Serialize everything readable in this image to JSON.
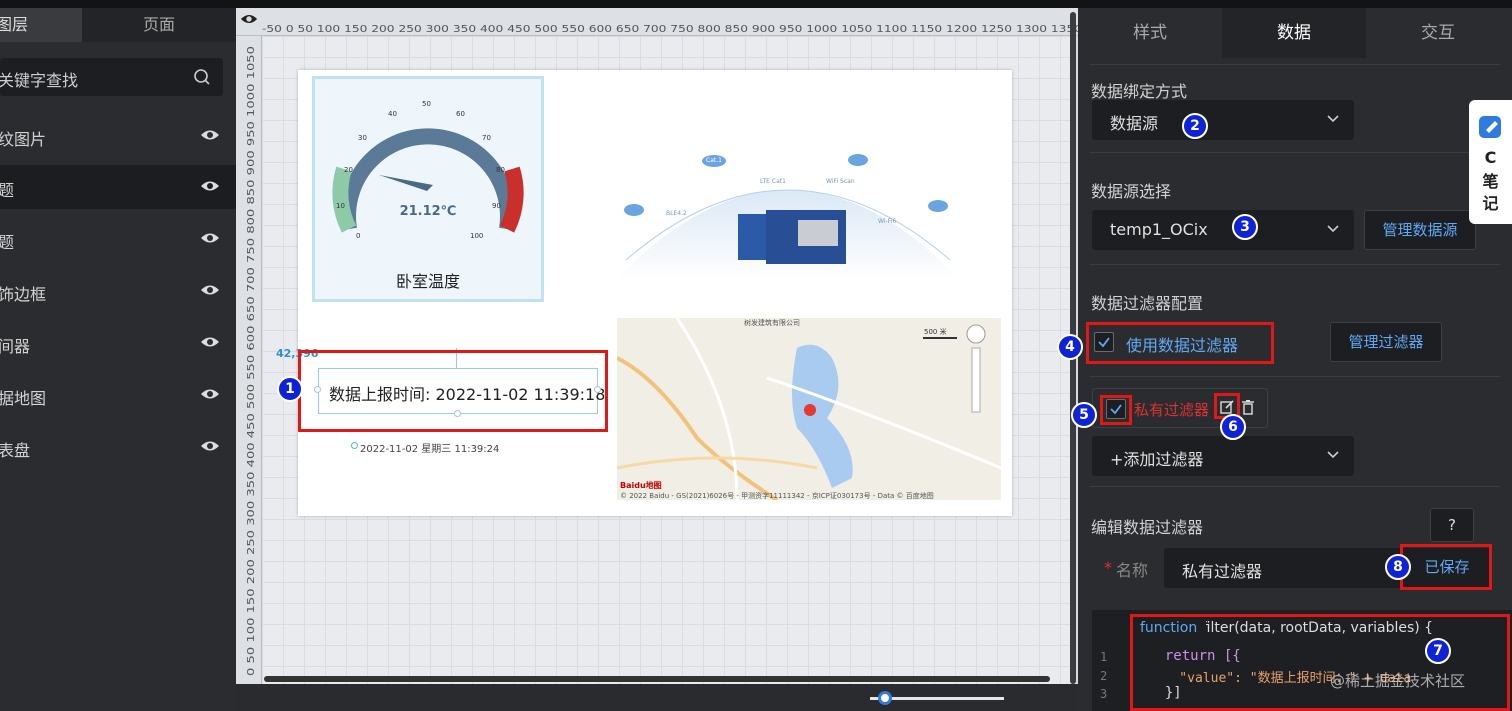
{
  "left_panel": {
    "tab_layers": "图层",
    "tab_pages": "页面",
    "search_placeholder": "关键字查找",
    "layers": [
      {
        "label": "纹图片"
      },
      {
        "label": "题"
      },
      {
        "label": "题"
      },
      {
        "label": "饰边框"
      },
      {
        "label": "间器"
      },
      {
        "label": "据地图"
      },
      {
        "label": "表盘"
      }
    ]
  },
  "canvas": {
    "ruler_top": "-50 0 50 100 150 200 250 300 350 400 450 500 550 600 650 700 750 800 850 900 950 1000 1050 1100 1150 1200 1250 1300 1350",
    "ruler_left": "0 50 100 150 200 250 300 350 400 450 500 550 600 650 700 750 800 850 900 950 1000 1050",
    "gauge": {
      "title": "卧室温度",
      "value": "21.12℃",
      "ticks": [
        "0",
        "10",
        "20",
        "30",
        "40",
        "50",
        "60",
        "70",
        "80",
        "90",
        "100"
      ]
    },
    "text_component": "数据上报时间: 2022-11-02 11:39:18",
    "datetime": "2022-11-02 星期三 11:39:24",
    "coord": "42,396",
    "map": {
      "copyright": "© 2022 Baidu - GS(2021)6026号 - 甲测资字11111342 - 京ICP证030173号 - Data © 百度地图",
      "logo": "Baidu地图",
      "scale": "500 米",
      "top_label": "树发建筑有限公司"
    },
    "iot_labels": [
      "Cat.1",
      "LTE Cat1",
      "WiFi Scan",
      "BLE4.2",
      "Wi-Fi6"
    ]
  },
  "right_panel": {
    "tabs": [
      "样式",
      "数据",
      "交互"
    ],
    "active_tab": "数据",
    "bind_mode_label": "数据绑定方式",
    "bind_mode_value": "数据源",
    "source_label": "数据源选择",
    "source_value": "temp1_OCix",
    "manage_source": "管理数据源",
    "filter_config_label": "数据过滤器配置",
    "use_filter": "使用数据过滤器",
    "manage_filter": "管理过滤器",
    "private_filter": "私有过滤器",
    "add_filter": "+添加过滤器",
    "edit_filter_label": "编辑数据过滤器",
    "help": "?",
    "name_label": "名称",
    "name_value": "私有过滤器",
    "saved": "已保存",
    "code_lines": [
      {
        "num": "",
        "text": "function filter(data, rootData, variables) {"
      },
      {
        "num": "1",
        "text": "  return [{"
      },
      {
        "num": "2",
        "text": "    \"value\": \"数据上报时间：\" + data"
      },
      {
        "num": "3",
        "text": "  }]"
      }
    ]
  },
  "notes_widget": {
    "line1": "C",
    "line2": "笔",
    "line3": "记"
  },
  "watermark": "@稀土掘金技术社区",
  "badges": [
    "1",
    "2",
    "3",
    "4",
    "5",
    "6",
    "7",
    "8"
  ],
  "colors": {
    "accent": "#5fa9f5",
    "highlight": "#e01818",
    "badge": "#0f22d8",
    "private_filter": "#e03030"
  }
}
